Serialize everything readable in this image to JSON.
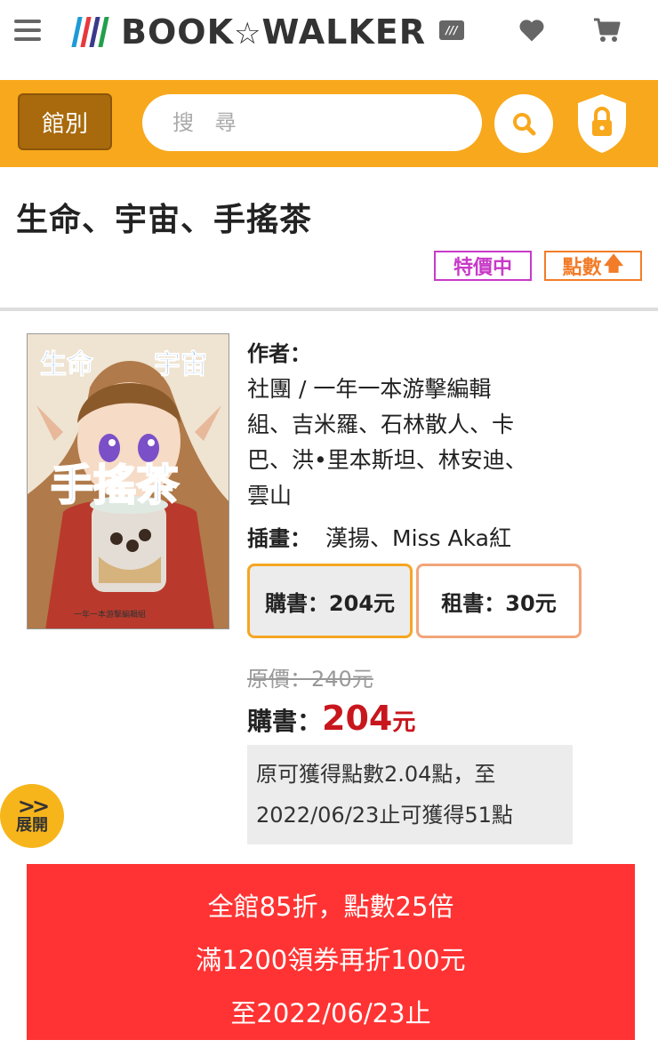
{
  "header": {
    "logo_text": "BOOK",
    "logo_star": "☆",
    "logo_text2": "WALKER",
    "logo_bar_colors": [
      "#1d9bd7",
      "#e8383d",
      "#3a3a8a",
      "#22a04b"
    ],
    "icons": [
      "menu-icon",
      "library-icon",
      "heart-icon",
      "cart-icon"
    ],
    "library_icon_text": "///"
  },
  "search": {
    "category_label": "館別",
    "placeholder": "搜 尋",
    "accent_color": "#f8a81c"
  },
  "product": {
    "title": "生命、宇宙、手搖茶",
    "tags": {
      "sale": "特價中",
      "points": "點數"
    },
    "cover_text": {
      "top": "生命",
      "top2": "宇宙",
      "main": "手搖茶",
      "publisher": "一年一本游擊編輯組"
    },
    "author_label": "作者：",
    "authors_lines": [
      "社團 / 一年一本游擊編輯",
      "組、吉米羅、石林散人、卡",
      "巴、洪•里本斯坦、林安迪、",
      "雲山"
    ],
    "illustrator_label": "插畫：",
    "illustrator": "漢揚、Miss Aka紅",
    "options": {
      "buy": "購書：204元",
      "rent": "租書：30元"
    },
    "original_price": "原價：240元",
    "buy_label": "購書：",
    "price": "204",
    "price_unit": "元",
    "points_lines": [
      "原可獲得點數2.04點，至",
      "2022/06/23止可獲得51點"
    ],
    "expand_label": "展開",
    "price_color": "#c8161d"
  },
  "promo": {
    "lines": [
      "全館85折，點數25倍",
      "滿1200領券再折100元",
      "至2022/06/23止"
    ],
    "background": "#ff3333"
  }
}
